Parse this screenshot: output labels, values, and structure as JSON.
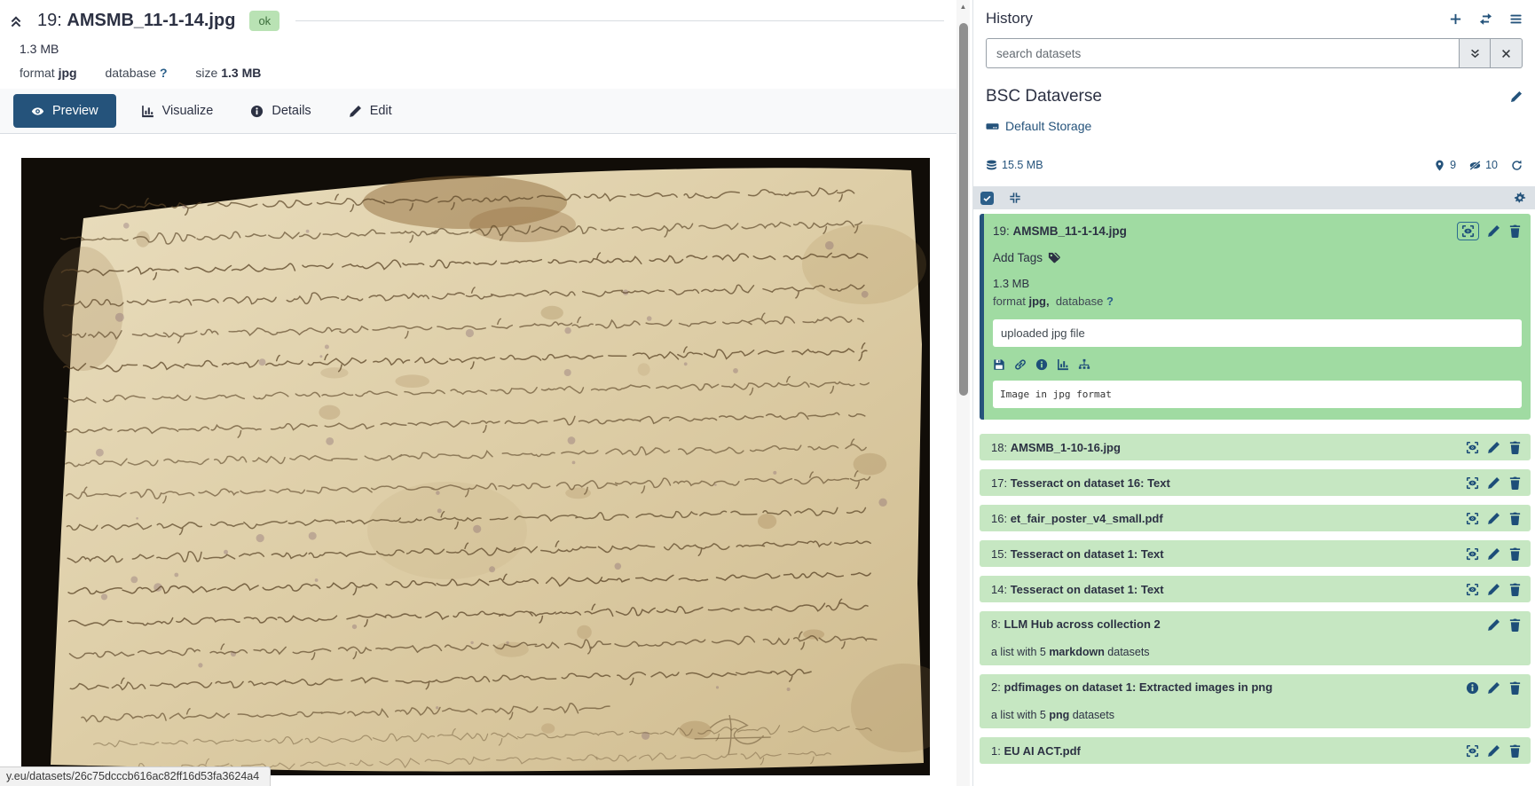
{
  "dataset_view": {
    "title_number": "19:",
    "title_name": "AMSMB_11-1-14.jpg",
    "status_badge": "ok",
    "size": "1.3 MB",
    "meta": {
      "format_label": "format",
      "format_value": "jpg",
      "database_label": "database",
      "database_value": "?",
      "size_label": "size",
      "size_value": "1.3 MB"
    },
    "tabs": {
      "preview": "Preview",
      "visualize": "Visualize",
      "details": "Details",
      "edit": "Edit"
    }
  },
  "status_bar": {
    "url": "y.eu/datasets/26c75dcccb616ac82ff16d53fa3624a4"
  },
  "history": {
    "title": "History",
    "search_placeholder": "search datasets",
    "name": "BSC Dataverse",
    "storage_link": "Default Storage",
    "size": "15.5 MB",
    "shown_count": "9",
    "hidden_count": "10",
    "expanded_item": {
      "number": "19:",
      "name": "AMSMB_11-1-14.jpg",
      "add_tags_label": "Add Tags",
      "size": "1.3 MB",
      "format_label": "format",
      "format_value": "jpg,",
      "database_label": "database",
      "database_value": "?",
      "info_box": "uploaded jpg file",
      "peek": "Image in jpg format"
    },
    "items": [
      {
        "number": "18:",
        "name": "AMSMB_1-10-16.jpg",
        "icons": [
          "display",
          "edit",
          "delete"
        ]
      },
      {
        "number": "17:",
        "name": "Tesseract on dataset 16: Text",
        "icons": [
          "display",
          "edit",
          "delete"
        ]
      },
      {
        "number": "16:",
        "name": "et_fair_poster_v4_small.pdf",
        "icons": [
          "display",
          "edit",
          "delete"
        ]
      },
      {
        "number": "15:",
        "name": "Tesseract on dataset 1: Text",
        "icons": [
          "display",
          "edit",
          "delete"
        ]
      },
      {
        "number": "14:",
        "name": "Tesseract on dataset 1: Text",
        "icons": [
          "display",
          "edit",
          "delete"
        ]
      },
      {
        "number": "8:",
        "name": "LLM Hub across collection 2",
        "icons": [
          "edit",
          "delete"
        ],
        "subtitle": {
          "pre": "a list with 5 ",
          "bold": "markdown",
          "post": " datasets"
        }
      },
      {
        "number": "2:",
        "name": "pdfimages on dataset 1: Extracted images in png",
        "icons": [
          "info",
          "edit",
          "delete"
        ],
        "subtitle": {
          "pre": "a list with 5 ",
          "bold": "png",
          "post": " datasets"
        }
      },
      {
        "number": "1:",
        "name": "EU AI ACT.pdf",
        "icons": [
          "display",
          "edit",
          "delete"
        ]
      }
    ],
    "colors": {
      "expanded_bg": "#a0dba2",
      "collapsed_bg": "#c6e7c2",
      "accent": "#25537b",
      "badge_bg": "#b9e2b4"
    }
  }
}
